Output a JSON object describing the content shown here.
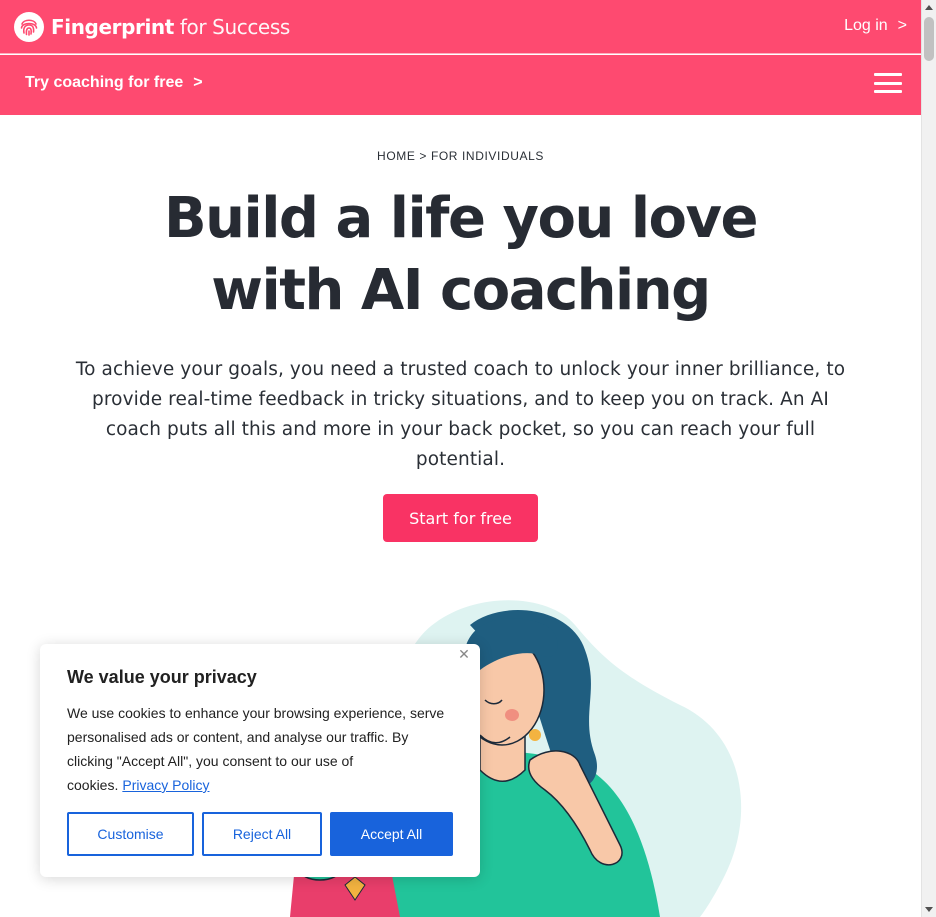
{
  "header": {
    "brand_bold": "Fingerprint",
    "brand_light": "for Success",
    "logo_icon": "fingerprint-icon",
    "login_label": "Log in",
    "login_chevron": ">"
  },
  "promo_bar": {
    "try_label": "Try coaching for free",
    "try_chevron": ">",
    "menu_icon": "hamburger-icon"
  },
  "breadcrumb": {
    "home": "HOME",
    "separator": ">",
    "current": "FOR INDIVIDUALS"
  },
  "hero": {
    "title_line1": "Build a life you love",
    "title_line2": "with AI coaching",
    "description": "To achieve your goals, you need a trusted coach to unlock your inner brilliance, to provide real-time feedback in tricky situations, and to keep you on track. An AI coach puts all this and more in your back pocket, so you can reach your full potential.",
    "cta_label": "Start for free"
  },
  "cookie_banner": {
    "title": "We value your privacy",
    "body": "We use cookies to enhance your browsing experience, serve personalised ads or content, and analyse our traffic. By clicking \"Accept All\", you consent to our use of cookies.",
    "policy_link": "Privacy Policy",
    "close_icon": "close-icon",
    "customise_label": "Customise",
    "reject_label": "Reject All",
    "accept_label": "Accept All"
  },
  "colors": {
    "brand_pink": "#fe4a70",
    "cta_pink": "#f93364",
    "cookie_blue": "#1863dc",
    "title_dark": "#272b33"
  }
}
